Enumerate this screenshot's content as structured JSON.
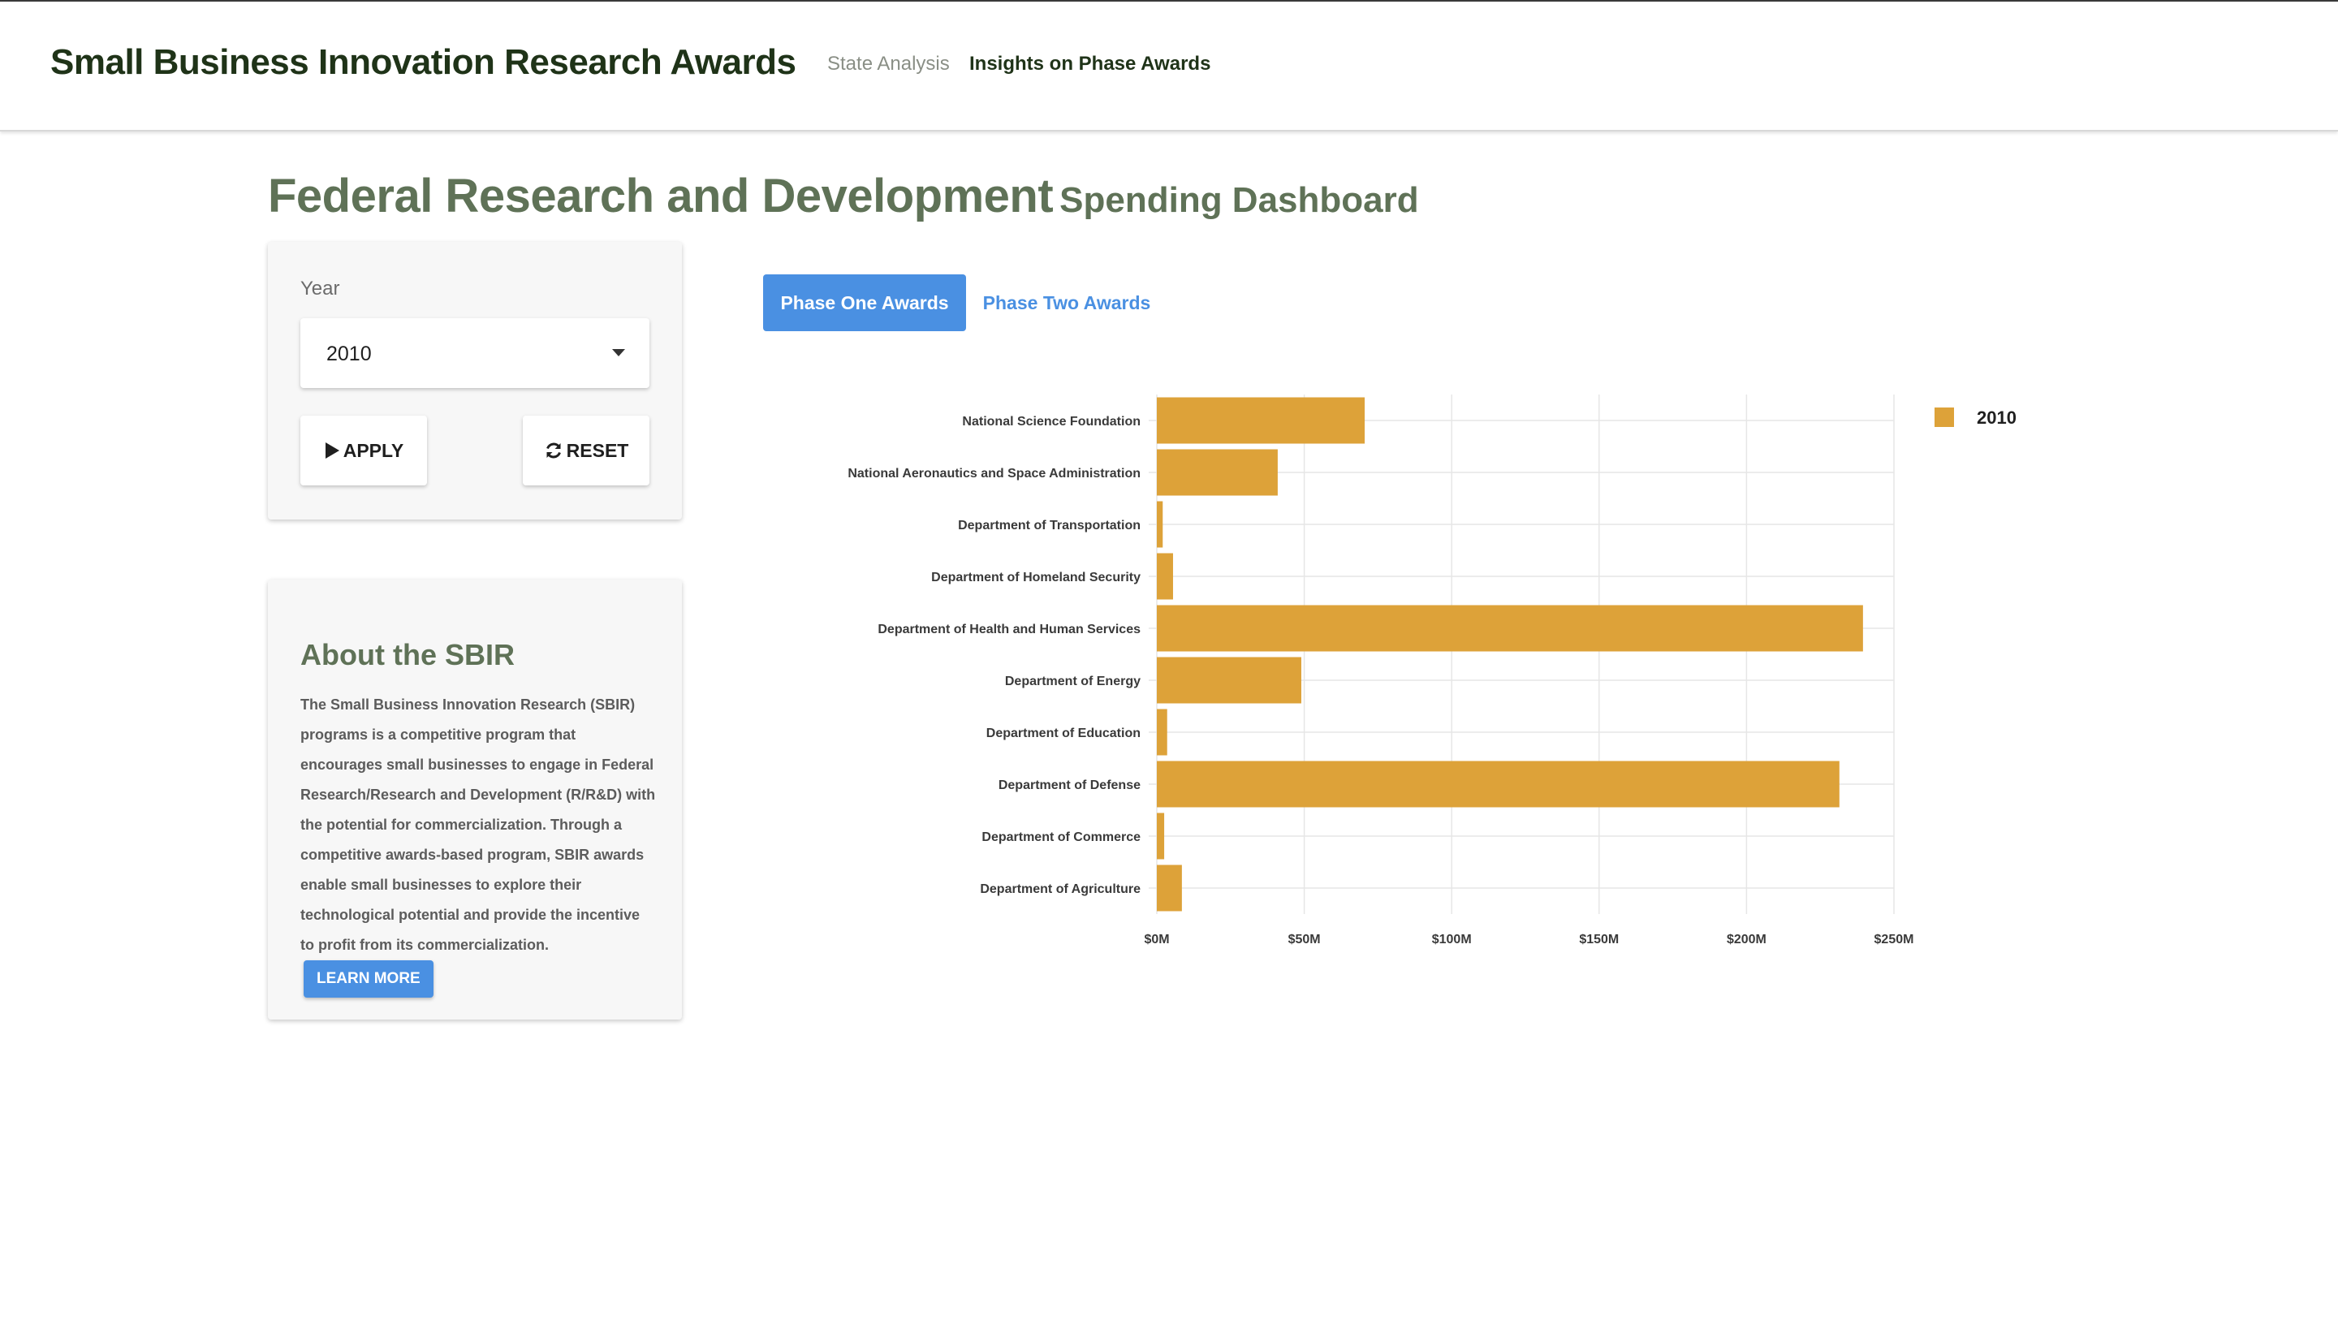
{
  "header": {
    "brand": "Small Business Innovation Research Awards",
    "nav": [
      "State Analysis",
      "Insights on Phase Awards"
    ]
  },
  "page_title": {
    "main": "Federal Research and Development",
    "sub": "Spending Dashboard"
  },
  "filter": {
    "year_label": "Year",
    "year_value": "2010",
    "apply_label": "APPLY",
    "reset_label": "RESET"
  },
  "about": {
    "title": "About the SBIR",
    "text": "The Small Business Innovation Research (SBIR) programs is a competitive program that encourages small businesses to engage in Federal Research/Research and Development (R/R&D) with the potential for commercialization. Through a competitive awards-based program, SBIR awards enable small businesses to explore their technological potential and provide the incentive to profit from its commercialization.",
    "learn_more": "LEARN MORE"
  },
  "tabs": {
    "phase_one": "Phase One Awards",
    "phase_two": "Phase Two Awards"
  },
  "colors": {
    "bar": "#DDA239",
    "accent": "#4a90e2",
    "title": "#5f7257"
  },
  "chart_data": {
    "type": "bar",
    "orientation": "horizontal",
    "categories": [
      "National Science Foundation",
      "National Aeronautics and Space Administration",
      "Department of Transportation",
      "Department of Homeland Security",
      "Department of Health and Human Services",
      "Department of Energy",
      "Department of Education",
      "Department of Defense",
      "Department of Commerce",
      "Department of Agriculture"
    ],
    "series": [
      {
        "name": "2010",
        "values": [
          70.5,
          41,
          2,
          5.5,
          239.5,
          49,
          3.5,
          231.5,
          2.5,
          8.5
        ]
      }
    ],
    "x_ticks": [
      "$0M",
      "$50M",
      "$100M",
      "$150M",
      "$200M",
      "$250M"
    ],
    "xlim": [
      0,
      250
    ],
    "unit": "$M",
    "grid": true,
    "legend": "top-right"
  }
}
